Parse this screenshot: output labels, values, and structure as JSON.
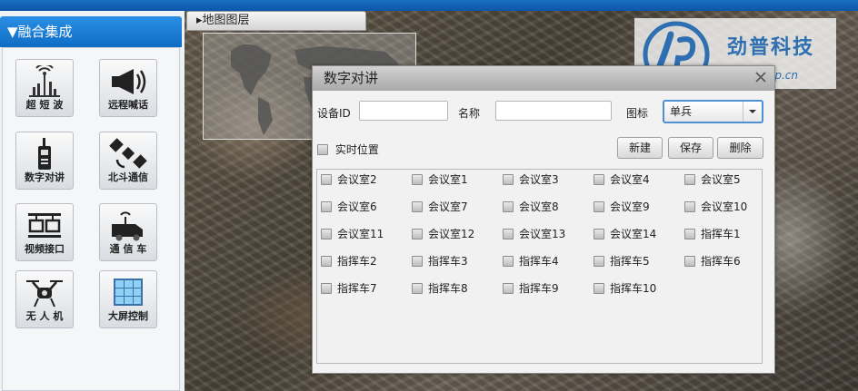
{
  "sidebar": {
    "header": "▼融合集成",
    "tools": [
      {
        "label": "超 短 波",
        "icon": "shortwave-icon"
      },
      {
        "label": "远程喊话",
        "icon": "megaphone-icon"
      },
      {
        "label": "数字对讲",
        "icon": "walkie-talkie-icon"
      },
      {
        "label": "北斗通信",
        "icon": "satellite-icon"
      },
      {
        "label": "视频接口",
        "icon": "video-interface-icon"
      },
      {
        "label": "通 信 车",
        "icon": "comm-vehicle-icon"
      },
      {
        "label": "无 人 机",
        "icon": "drone-icon"
      },
      {
        "label": "大屏控制",
        "icon": "big-screen-icon"
      }
    ]
  },
  "map": {
    "layer_tab": "▸地图图层"
  },
  "logo": {
    "text": "劲普科技",
    "url": "www.cd-jp.cn"
  },
  "dialog": {
    "title": "数字对讲",
    "device_id_label": "设备ID",
    "device_id_value": "",
    "name_label": "名称",
    "name_value": "",
    "icon_label": "图标",
    "icon_selected": "单兵",
    "realtime_label": "实时位置",
    "buttons": {
      "new": "新建",
      "save": "保存",
      "delete": "删除"
    },
    "items": [
      "会议室2",
      "会议室1",
      "会议室3",
      "会议室4",
      "会议室5",
      "会议室6",
      "会议室7",
      "会议室8",
      "会议室9",
      "会议室10",
      "会议室11",
      "会议室12",
      "会议室13",
      "会议室14",
      "指挥车1",
      "指挥车2",
      "指挥车3",
      "指挥车4",
      "指挥车5",
      "指挥车6",
      "指挥车7",
      "指挥车8",
      "指挥车9",
      "指挥车10"
    ]
  },
  "colors": {
    "accent": "#1877d2",
    "logo_blue": "#2d6fb0"
  }
}
